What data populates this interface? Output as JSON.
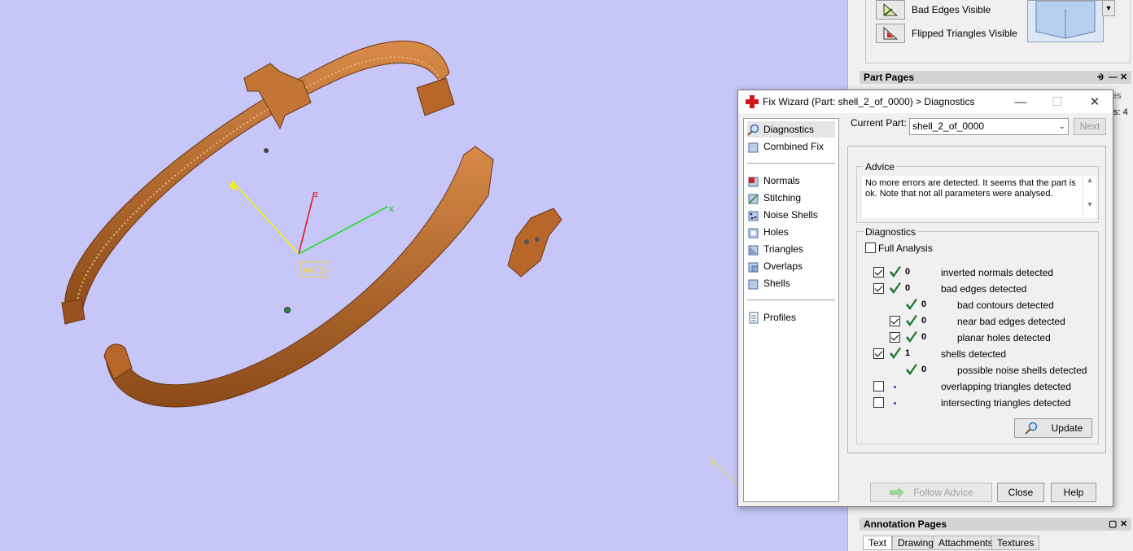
{
  "viewport": {
    "wcs_label": "WCS",
    "axes": {
      "x": "x",
      "y": "y",
      "z": "z"
    },
    "corner_axis_label": "Y"
  },
  "visibility": {
    "bad_edges": "Bad Edges Visible",
    "flipped_triangles": "Flipped Triangles Visible"
  },
  "part_pages": {
    "title": "Part Pages",
    "pin": "⨮",
    "minimize": "—",
    "close": "✕",
    "partial_tab": "es",
    "partial_text": "s: 4"
  },
  "annotation_pages": {
    "title": "Annotation Pages",
    "tabs": [
      "Text",
      "Drawing",
      "Attachments",
      "Textures"
    ]
  },
  "dialog": {
    "title": "Fix Wizard (Part: shell_2_of_0000) > Diagnostics",
    "minimize": "—",
    "maximize": "☐",
    "close": "✕",
    "nav_top": [
      {
        "label": "Diagnostics",
        "icon": "magnifier-icon"
      },
      {
        "label": "Combined Fix",
        "icon": "combined-fix-icon"
      }
    ],
    "nav_mid": [
      {
        "label": "Normals",
        "icon": "normals-icon"
      },
      {
        "label": "Stitching",
        "icon": "stitching-icon"
      },
      {
        "label": "Noise Shells",
        "icon": "noise-shells-icon"
      },
      {
        "label": "Holes",
        "icon": "holes-icon"
      },
      {
        "label": "Triangles",
        "icon": "triangles-icon"
      },
      {
        "label": "Overlaps",
        "icon": "overlaps-icon"
      },
      {
        "label": "Shells",
        "icon": "shells-icon"
      }
    ],
    "nav_bottom": [
      {
        "label": "Profiles",
        "icon": "profiles-icon"
      }
    ],
    "current_part_label": "Current Part:",
    "current_part_value": "shell_2_of_0000",
    "next_label": "Next",
    "advice_title": "Advice",
    "advice_text": "No more errors are detected. It seems that the part is ok. Note that not all parameters were analysed.",
    "diagnostics_title": "Diagnostics",
    "full_analysis_label": "Full Analysis",
    "rows": [
      {
        "checkbox": true,
        "checked": true,
        "status": "ok",
        "count": "0",
        "label": "inverted normals detected",
        "indent": 0
      },
      {
        "checkbox": true,
        "checked": true,
        "status": "ok",
        "count": "0",
        "label": "bad edges detected",
        "indent": 0
      },
      {
        "checkbox": false,
        "checked": false,
        "status": "ok",
        "count": "0",
        "label": "bad contours detected",
        "indent": 1
      },
      {
        "checkbox": true,
        "checked": true,
        "status": "ok",
        "count": "0",
        "label": "near bad edges detected",
        "indent": 1
      },
      {
        "checkbox": true,
        "checked": true,
        "status": "ok",
        "count": "0",
        "label": "planar holes detected",
        "indent": 1
      },
      {
        "checkbox": true,
        "checked": true,
        "status": "ok",
        "count": "1",
        "label": "shells detected",
        "indent": 0
      },
      {
        "checkbox": false,
        "checked": false,
        "status": "ok",
        "count": "0",
        "label": "possible noise shells detected",
        "indent": 1
      },
      {
        "checkbox": true,
        "checked": false,
        "status": "pending",
        "count": "",
        "label": "overlapping triangles detected",
        "indent": 0
      },
      {
        "checkbox": true,
        "checked": false,
        "status": "pending",
        "count": "",
        "label": "intersecting triangles detected",
        "indent": 0
      }
    ],
    "update_label": "Update",
    "follow_advice_label": "Follow Advice",
    "close_label": "Close",
    "help_label": "Help"
  },
  "colors": {
    "viewport_bg": "#c6c6f8",
    "part": "#b8662a",
    "ok_tick": "#1e7a2a",
    "pending_dot": "#1f3fd0"
  }
}
